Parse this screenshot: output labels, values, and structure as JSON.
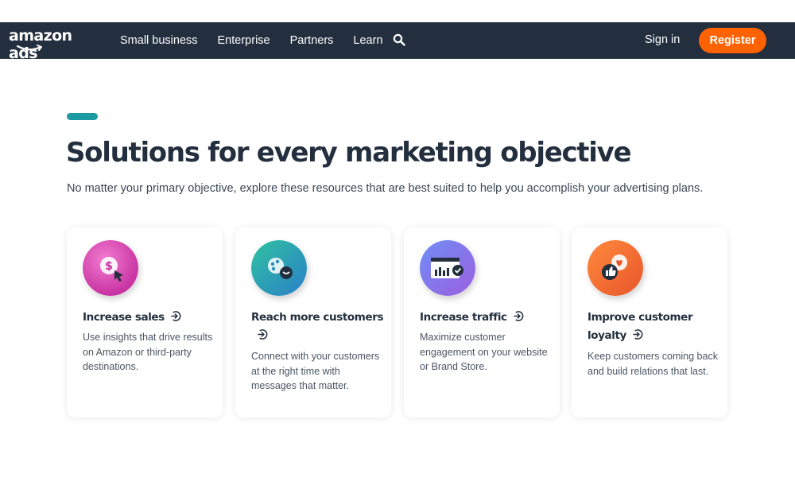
{
  "header": {
    "logo_text": "amazon ads",
    "nav": [
      "Small business",
      "Enterprise",
      "Partners",
      "Learn"
    ],
    "search_icon": "search-icon",
    "signin_label": "Sign in",
    "register_label": "Register"
  },
  "main": {
    "heading": "Solutions for every marketing objective",
    "subheading": "No matter your primary objective, explore these resources that are best suited to help you accomplish your advertising plans.",
    "cards": [
      {
        "title": "Increase sales",
        "description": "Use insights that drive results on Amazon or third-party destinations.",
        "icon": "dollar-cursor-icon"
      },
      {
        "title": "Reach more customers",
        "description": "Connect with your customers at the right time with messages that matter.",
        "icon": "people-chat-icon"
      },
      {
        "title": "Increase traffic",
        "description": "Maximize customer engagement on your website or Brand Store.",
        "icon": "browser-chart-icon"
      },
      {
        "title": "Improve customer loyalty",
        "description": "Keep customers coming back and build relations that last.",
        "icon": "thumbs-up-heart-icon"
      }
    ]
  },
  "colors": {
    "nav_bg": "#232f3e",
    "register_bg": "#ff6200",
    "accent_teal": "#1b9aa2"
  }
}
